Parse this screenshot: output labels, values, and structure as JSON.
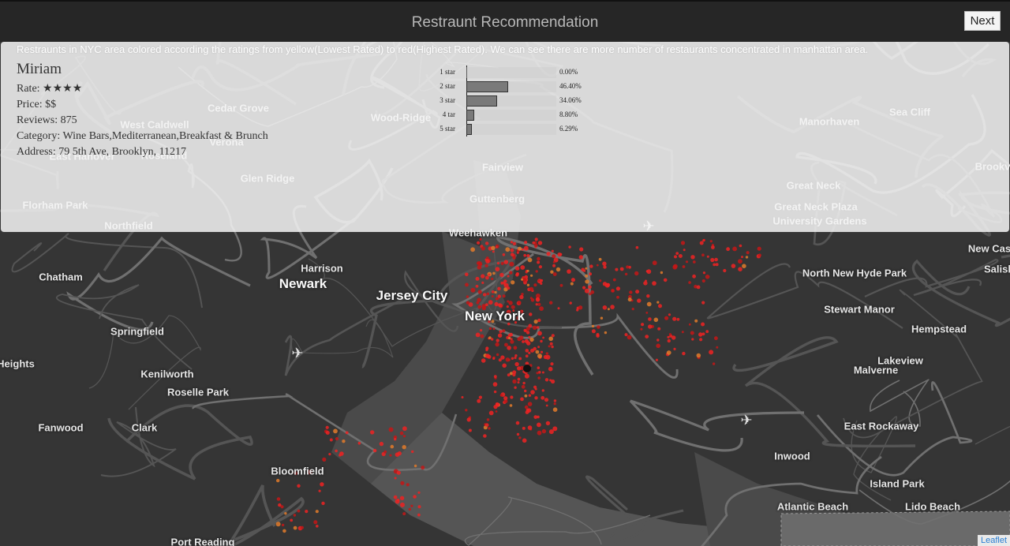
{
  "header": {
    "title": "Restraunt Recommendation",
    "next_label": "Next"
  },
  "description": "Restraunts in NYC area colored according the ratings from yellow(Lowest Rated) to red(Highest Rated). We can see there are more number of restaurants concentrated in manhattan area.",
  "restaurant": {
    "name": "Miriam",
    "rate_label": "Rate:",
    "rate_stars": "★★★★",
    "price": "Price: $$",
    "reviews": "Reviews: 875",
    "category": "Category: Wine Bars,Mediterranean,Breakfast & Brunch",
    "address": "Address: 79 5th Ave, Brooklyn, 11217"
  },
  "rating_histogram": [
    {
      "label": "1 star",
      "value": "0.00%",
      "pct": 0.0
    },
    {
      "label": "2 star",
      "value": "46.40%",
      "pct": 46.4
    },
    {
      "label": "3 star",
      "value": "34.06%",
      "pct": 34.06
    },
    {
      "label": "4 tar",
      "value": "8.80%",
      "pct": 8.8
    },
    {
      "label": "5 star",
      "value": "6.29%",
      "pct": 6.29
    }
  ],
  "map": {
    "attribution": "Leaflet",
    "place_labels": [
      "Newark",
      "Jersey City",
      "New York",
      "Harrison",
      "Chatham",
      "Springfield",
      "Kenilworth",
      "Roselle Park",
      "Fanwood",
      "Clark",
      "Heights",
      "Bloomfield",
      "Weehawken",
      "Fairview",
      "Guttenberg",
      "Cedar Grove",
      "West Caldwell",
      "Verona",
      "East Hanover",
      "Roseland",
      "Glen Ridge",
      "Florham Park",
      "Northfield",
      "Wood-Ridge",
      "Manorhaven",
      "Sea Cliff",
      "Great Neck",
      "Great Neck Plaza",
      "University Gardens",
      "New Cas",
      "Salisl",
      "North New Hyde Park",
      "Stewart Manor",
      "Hempstead",
      "Lakeview",
      "Malverne",
      "East Rockaway",
      "Inwood",
      "Island Park",
      "Atlantic Beach",
      "Lido Beach",
      "Port Reading",
      "Brookv"
    ]
  }
}
